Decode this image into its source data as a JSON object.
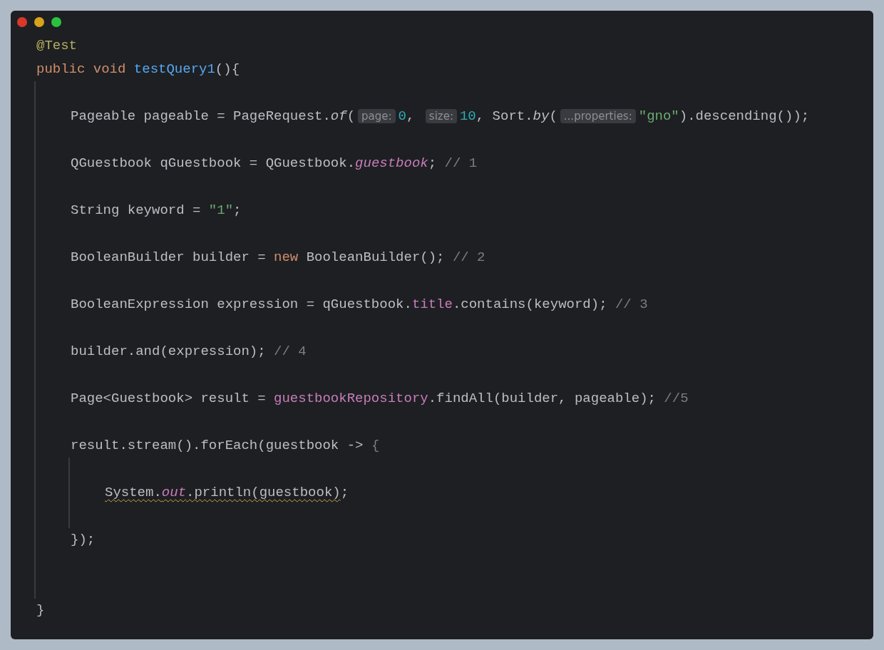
{
  "window": {
    "controls": [
      {
        "color": "#d9372b"
      },
      {
        "color": "#d9a21b"
      },
      {
        "color": "#2ac340"
      }
    ]
  },
  "code": [
    {
      "kind": "code",
      "tokens": [
        {
          "kind": "annotation",
          "text": "@Test"
        }
      ]
    },
    {
      "kind": "code",
      "tokens": [
        {
          "kind": "keyword",
          "text": "public void "
        },
        {
          "kind": "declaration",
          "text": "testQuery1"
        },
        {
          "kind": "plain",
          "text": "(){"
        }
      ],
      "children": [
        {
          "kind": "blank"
        },
        {
          "kind": "code",
          "tokens": [
            {
              "kind": "plain",
              "text": "Pageable pageable = PageRequest."
            },
            {
              "kind": "static_call",
              "text": "of"
            },
            {
              "kind": "plain",
              "text": "("
            },
            {
              "kind": "hint",
              "text": "page:"
            },
            {
              "kind": "number",
              "text": "0"
            },
            {
              "kind": "plain",
              "text": ", "
            },
            {
              "kind": "hint",
              "text": "size:"
            },
            {
              "kind": "number",
              "text": "10"
            },
            {
              "kind": "plain",
              "text": ", Sort."
            },
            {
              "kind": "static_call",
              "text": "by"
            },
            {
              "kind": "plain",
              "text": "("
            },
            {
              "kind": "hint",
              "text": "...properties:"
            },
            {
              "kind": "string",
              "text": "\"gno\""
            },
            {
              "kind": "plain",
              "text": ").descending());"
            }
          ]
        },
        {
          "kind": "blank"
        },
        {
          "kind": "code",
          "tokens": [
            {
              "kind": "plain",
              "text": "QGuestbook qGuestbook = QGuestbook."
            },
            {
              "kind": "static_field",
              "text": "guestbook"
            },
            {
              "kind": "plain",
              "text": "; "
            },
            {
              "kind": "comment",
              "text": "// 1"
            }
          ]
        },
        {
          "kind": "blank"
        },
        {
          "kind": "code",
          "tokens": [
            {
              "kind": "plain",
              "text": "String keyword = "
            },
            {
              "kind": "string",
              "text": "\"1\""
            },
            {
              "kind": "plain",
              "text": ";"
            }
          ]
        },
        {
          "kind": "blank"
        },
        {
          "kind": "code",
          "tokens": [
            {
              "kind": "plain",
              "text": "BooleanBuilder builder = "
            },
            {
              "kind": "keyword",
              "text": "new"
            },
            {
              "kind": "plain",
              "text": " BooleanBuilder(); "
            },
            {
              "kind": "comment",
              "text": "// 2"
            }
          ]
        },
        {
          "kind": "blank"
        },
        {
          "kind": "code",
          "tokens": [
            {
              "kind": "plain",
              "text": "BooleanExpression expression = qGuestbook."
            },
            {
              "kind": "field",
              "text": "title"
            },
            {
              "kind": "plain",
              "text": ".contains(keyword); "
            },
            {
              "kind": "comment",
              "text": "// 3"
            }
          ]
        },
        {
          "kind": "blank"
        },
        {
          "kind": "code",
          "tokens": [
            {
              "kind": "plain",
              "text": "builder.and(expression); "
            },
            {
              "kind": "comment",
              "text": "// 4"
            }
          ]
        },
        {
          "kind": "blank"
        },
        {
          "kind": "code",
          "tokens": [
            {
              "kind": "plain",
              "text": "Page<Guestbook> result = "
            },
            {
              "kind": "field",
              "text": "guestbookRepository"
            },
            {
              "kind": "plain",
              "text": ".findAll(builder, pageable); "
            },
            {
              "kind": "comment",
              "text": "//5"
            }
          ]
        },
        {
          "kind": "blank"
        },
        {
          "kind": "code",
          "tokens": [
            {
              "kind": "plain",
              "text": "result.stream().forEach(guestbook -> "
            },
            {
              "kind": "dim",
              "text": "{"
            }
          ],
          "children": [
            {
              "kind": "blank"
            },
            {
              "kind": "code",
              "tokens": [
                {
                  "kind": "plain",
                  "text": "System.",
                  "warning": true
                },
                {
                  "kind": "static_field",
                  "text": "out",
                  "warning": true
                },
                {
                  "kind": "plain",
                  "text": ".println(guestbook)",
                  "warning": true
                },
                {
                  "kind": "plain",
                  "text": ";",
                  "warning": false
                }
              ]
            },
            {
              "kind": "blank"
            }
          ]
        },
        {
          "kind": "code",
          "tokens": [
            {
              "kind": "plain",
              "text": "});"
            }
          ]
        },
        {
          "kind": "blank"
        },
        {
          "kind": "blank"
        }
      ]
    },
    {
      "kind": "code",
      "tokens": [
        {
          "kind": "plain",
          "text": "}"
        }
      ]
    }
  ]
}
